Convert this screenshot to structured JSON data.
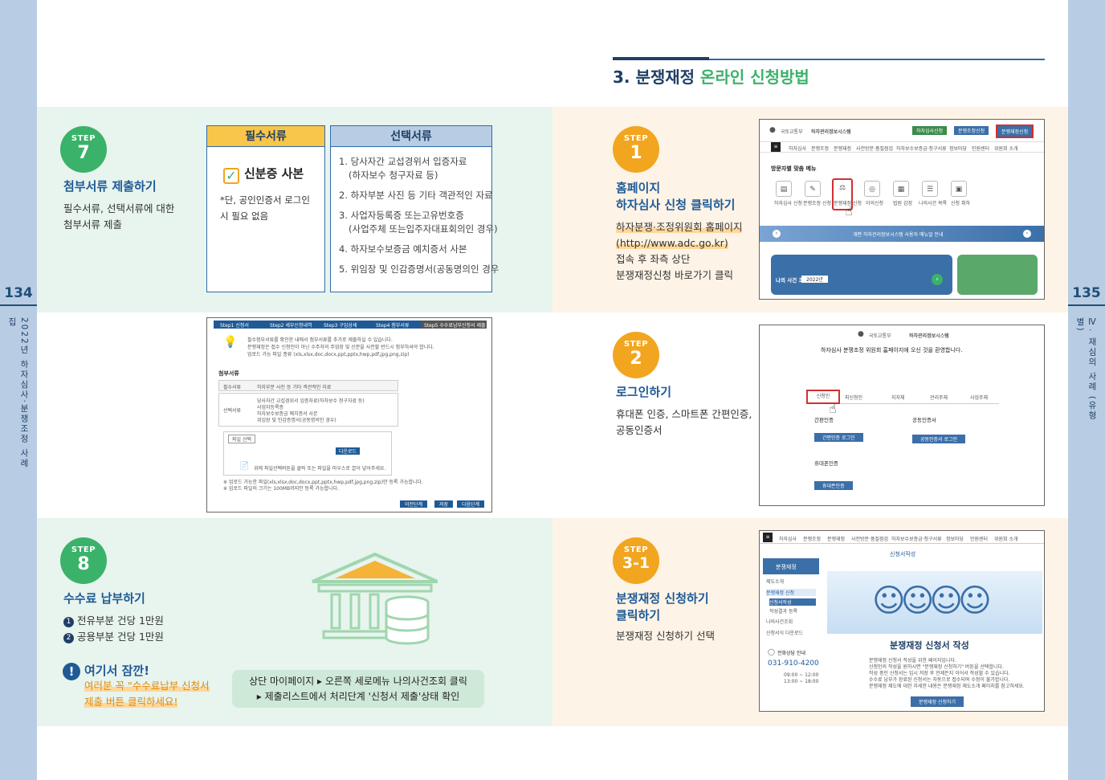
{
  "pages": {
    "left": "134",
    "right": "135"
  },
  "side_text": {
    "left": "2022년 하자심사·분쟁조정 사례집",
    "right": "Ⅳ. 재심의 사례 (유형별)"
  },
  "title": {
    "prefix": "3. 분쟁재정",
    "highlight": "온라인 신청방법"
  },
  "step7": {
    "badge_label": "STEP",
    "badge_num": "7",
    "heading": "첨부서류 제출하기",
    "body": [
      "필수서류, 선택서류에 대한",
      "첨부서류 제출"
    ],
    "required": {
      "header": "필수서류",
      "item": "신분증 사본",
      "note": "*단, 공인인증서 로그인 시 필요 없음"
    },
    "optional": {
      "header": "선택서류",
      "items": [
        [
          "1. 당사자간 교섭경위서 입증자료",
          "(하자보수 청구자료 등)"
        ],
        [
          "2. 하자부분 사진 등 기타 객관적인 자료"
        ],
        [
          "3. 사업자등록증 또는고유번호증",
          "(사업주체 또는입주자대표회의인 경우)"
        ],
        [
          "4. 하자보수보증금 예치증서 사본"
        ],
        [
          "5. 위임장 및 인감증명서(공동명의인 경우"
        ]
      ]
    },
    "screenshot": {
      "steps": [
        "Step1 신청서",
        "Step2 세부신청내역",
        "Step3 구입상세",
        "Step4 첨부서류",
        "Step5 수수료납부신청서 제출"
      ],
      "notes": [
        "필수첨부서류를 확인한 내에서 첨부서류를 추가로 제출하실 수 있습니다.",
        "분쟁재정은 접수 신청인이 아닌 수주자의 주업장 및 신분을 사전할 반드시 첨부하셔야 합니다.",
        "업로드 가능 파일 종류 (xls,xlsx,doc,docx,ppt,pptx,hwp,pdf,jpg,png,zip)"
      ],
      "section": "첨부서류",
      "row1_label": "필수서류",
      "row1_value": "하자부분 사진 등 기타 객관적인 자료",
      "row2_label": "선택서류",
      "row2_values": [
        "당사자간 교섭경위서 입증자료(하자보수 청구자료 등)",
        "사업자등록증",
        "하자보수보증금 예치증서 사본",
        "위임장 및 인감증명서(공동명의인 경우)"
      ],
      "file_btn": "파일 선택",
      "upload_btn": "다운로드",
      "drop_hint": "위에 파일선택버튼을 클릭 또는 파일을 마우스로 끌어 넣어주세요.",
      "foot1": "※ 업로드 가능한 파일(xls,xlsx,doc,docx,ppt,pptx,hwp,pdf,jpg,png,zip)만 등록 가능합니다.",
      "foot2": "※ 업로드 파일의 크기는 100MB까지만 등록 가능합니다.",
      "buttons": [
        "이전단계",
        "저장",
        "다음단계"
      ]
    }
  },
  "step1": {
    "badge_label": "STEP",
    "badge_num": "1",
    "heading": [
      "홈페이지",
      "하자심사 신청 클릭하기"
    ],
    "link": [
      "하자분쟁·조정위원회 홈페이지",
      "(http://www.adc.go.kr)"
    ],
    "body": [
      "접속 후 좌측 상단",
      "분쟁재정신청 바로가기 클릭"
    ],
    "screenshot": {
      "org": "국토교통부",
      "site": "하자관리정보시스템",
      "top_btns": [
        "하자심사신청",
        "분쟁조정신청",
        "분쟁재정신청"
      ],
      "menu": [
        "하자심사",
        "분쟁조정",
        "분쟁재정",
        "사전방문·품질점검",
        "하자보수보증금·청구서류",
        "정보마당",
        "민원센터",
        "위원회 소개"
      ],
      "section": "방문자별 맞춤 메뉴",
      "icons": [
        "하자심사 신청",
        "분쟁조정 신청",
        "분쟁재정 신청",
        "이의신청",
        "법원 감정",
        "나의사건 목록",
        "신청 취하"
      ],
      "banner": "개편 하자관리정보시스템 사용자 매뉴얼 안내",
      "search_label": "나의 사건 조회",
      "search_year": "2022년"
    }
  },
  "step2": {
    "badge_label": "STEP",
    "badge_num": "2",
    "heading": "로그인하기",
    "body": [
      "휴대폰 인증, 스마트폰 간편인증,",
      "공동인증서"
    ],
    "screenshot": {
      "org": "국토교통부",
      "site": "하자관리정보시스템",
      "welcome": "하자심사 분쟁조정 위원회 홈페이지에 오신 것을 환영합니다.",
      "tabs": [
        "신청인",
        "피신청인",
        "지자체",
        "관리주체",
        "사업주체"
      ],
      "box1_title": "간편인증",
      "box1_btn": "간편인증 로그인",
      "box2_title": "공동인증서",
      "box2_btn": "공동인증서 로그인",
      "box3_title": "휴대폰인증",
      "box3_btn": "휴대폰인증"
    }
  },
  "step8": {
    "badge_label": "STEP",
    "badge_num": "8",
    "heading": "수수료 납부하기",
    "items": [
      {
        "n": "1",
        "text": "전유부분 건당 1만원"
      },
      {
        "n": "2",
        "text": "공용부분 건당 1만원"
      }
    ],
    "warn_title": "여기서 잠깐!",
    "warn_body": [
      "여러분 꼭 \"수수료납부 신청서",
      "제출 버튼 클릭하세요!"
    ],
    "tip": [
      "상단 마이페이지 ▸ 오른쪽 세로메뉴 나의사건조회 클릭",
      "▸ 제출리스트에서 처리단계 '신청서 제출'상태 확인"
    ]
  },
  "step31": {
    "badge_label": "STEP",
    "badge_num": "3-1",
    "heading": [
      "분쟁재정 신청하기",
      "클릭하기"
    ],
    "body": "분쟁재정 신청하기 선택",
    "screenshot": {
      "menu": [
        "하자심사",
        "분쟁조정",
        "분쟁재정",
        "사전방문·품질점검",
        "하자보수보증금·청구서류",
        "정보마당",
        "민원센터",
        "위원회 소개"
      ],
      "side_title": "분쟁재정",
      "side_items": [
        "제도소개",
        "분쟁재정 신청",
        "신청서작성",
        "작성결과 등록",
        "나의사건조회",
        "신청서식 다운로드"
      ],
      "page_title": "신청서작성",
      "phone_label": "전화상담 안내",
      "phone": "031-910-4200",
      "hours": [
        "09:00 ~ 12:00",
        "13:00 ~ 18:00"
      ],
      "headline": "분쟁재정 신청서 작성",
      "bullets": [
        "분쟁재정 신청서 작성을 위한 페이지입니다.",
        "신청인의 작성을 원하시면 \"분쟁재정 신청하기\" 버튼을 선택합니다.",
        "작성 중인 신청서는 임시 저장 후 언제든지 이어서 작성할 수 있습니다.",
        "수수료 납부가 완료된 신청서는 자동으로 접수되며 수정이 불가합니다.",
        "분쟁재정 제도에 대한 자세한 내용은 분쟁재정 제도소개 페이지를 참고하세요."
      ],
      "button": "분쟁재정 신청하기"
    }
  },
  "colors": {
    "navy": "#1f3f66",
    "blue": "#1f5a96",
    "green": "#3bb26a",
    "orange": "#f2a51f",
    "mint_bg": "#e8f4ee",
    "cream_bg": "#fdf3e6"
  }
}
